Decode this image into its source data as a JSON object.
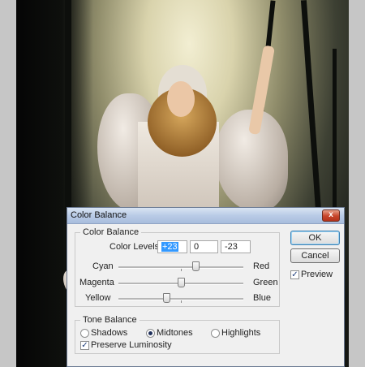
{
  "dialog": {
    "title": "Color Balance",
    "close_glyph": "x",
    "color_balance_group": "Color Balance",
    "levels_label": "Color Levels:",
    "levels": [
      "+23",
      "0",
      "-23"
    ],
    "sliders": [
      {
        "left": "Cyan",
        "right": "Red",
        "value": 23
      },
      {
        "left": "Magenta",
        "right": "Green",
        "value": 0
      },
      {
        "left": "Yellow",
        "right": "Blue",
        "value": -23
      }
    ],
    "tone_group": "Tone Balance",
    "tones": [
      {
        "label": "Shadows",
        "selected": false
      },
      {
        "label": "Midtones",
        "selected": true
      },
      {
        "label": "Highlights",
        "selected": false
      }
    ],
    "preserve_luminosity": {
      "label": "Preserve Luminosity",
      "checked": true
    },
    "ok_label": "OK",
    "cancel_label": "Cancel",
    "preview": {
      "label": "Preview",
      "checked": true
    },
    "check_glyph": "✓"
  }
}
